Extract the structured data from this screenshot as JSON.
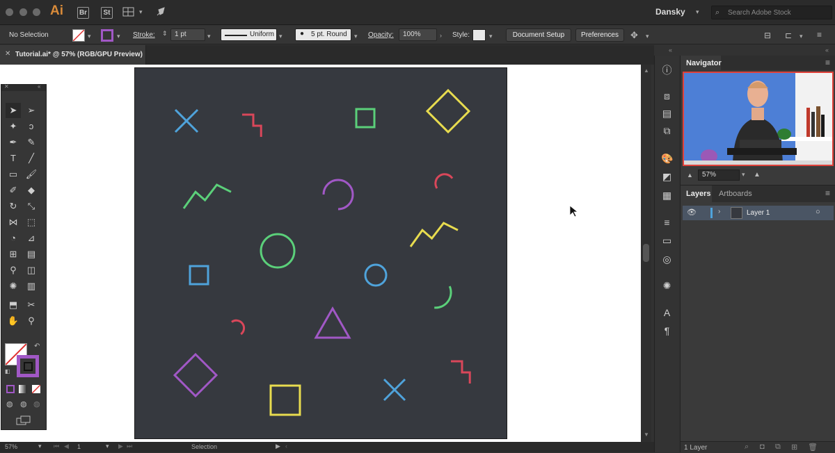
{
  "app": {
    "logo": "Ai",
    "bridge": "Br",
    "stock": "St",
    "workspace": "Dansky",
    "search_placeholder": "Search Adobe Stock"
  },
  "control": {
    "selection": "No Selection",
    "stroke_label": "Stroke:",
    "stroke_weight": "1 pt",
    "profile": "Uniform",
    "brush": "5 pt. Round",
    "opacity_label": "Opacity:",
    "opacity": "100%",
    "style_label": "Style:",
    "doc_setup": "Document Setup",
    "preferences": "Preferences"
  },
  "document": {
    "tab_title": "Tutorial.ai* @ 57% (RGB/GPU Preview)"
  },
  "status": {
    "zoom": "57%",
    "artboard": "1",
    "mode": "Selection"
  },
  "navigator": {
    "title": "Navigator",
    "zoom": "57%"
  },
  "layers": {
    "tab": "Layers",
    "artboards_tab": "Artboards",
    "layer_name": "Layer 1",
    "count": "1 Layer"
  },
  "colors": {
    "bg": "#36393f",
    "blue": "#4fa3db",
    "red": "#d9475a",
    "green": "#5bd07a",
    "yellow": "#e8dc4f",
    "purple": "#a158c6"
  },
  "shapes": [
    {
      "type": "x",
      "color": "blue"
    },
    {
      "type": "zigzag",
      "color": "red"
    },
    {
      "type": "square",
      "color": "green"
    },
    {
      "type": "diamond",
      "color": "yellow"
    },
    {
      "type": "zigzag",
      "color": "green"
    },
    {
      "type": "arc",
      "color": "purple"
    },
    {
      "type": "arc",
      "color": "red"
    },
    {
      "type": "circle",
      "color": "green"
    },
    {
      "type": "zigzag",
      "color": "yellow"
    },
    {
      "type": "square",
      "color": "blue"
    },
    {
      "type": "circle",
      "color": "blue"
    },
    {
      "type": "arc",
      "color": "green"
    },
    {
      "type": "arc",
      "color": "red"
    },
    {
      "type": "triangle",
      "color": "purple"
    },
    {
      "type": "diamond",
      "color": "purple"
    },
    {
      "type": "square",
      "color": "yellow"
    },
    {
      "type": "x",
      "color": "blue"
    },
    {
      "type": "zigzag",
      "color": "red"
    }
  ]
}
